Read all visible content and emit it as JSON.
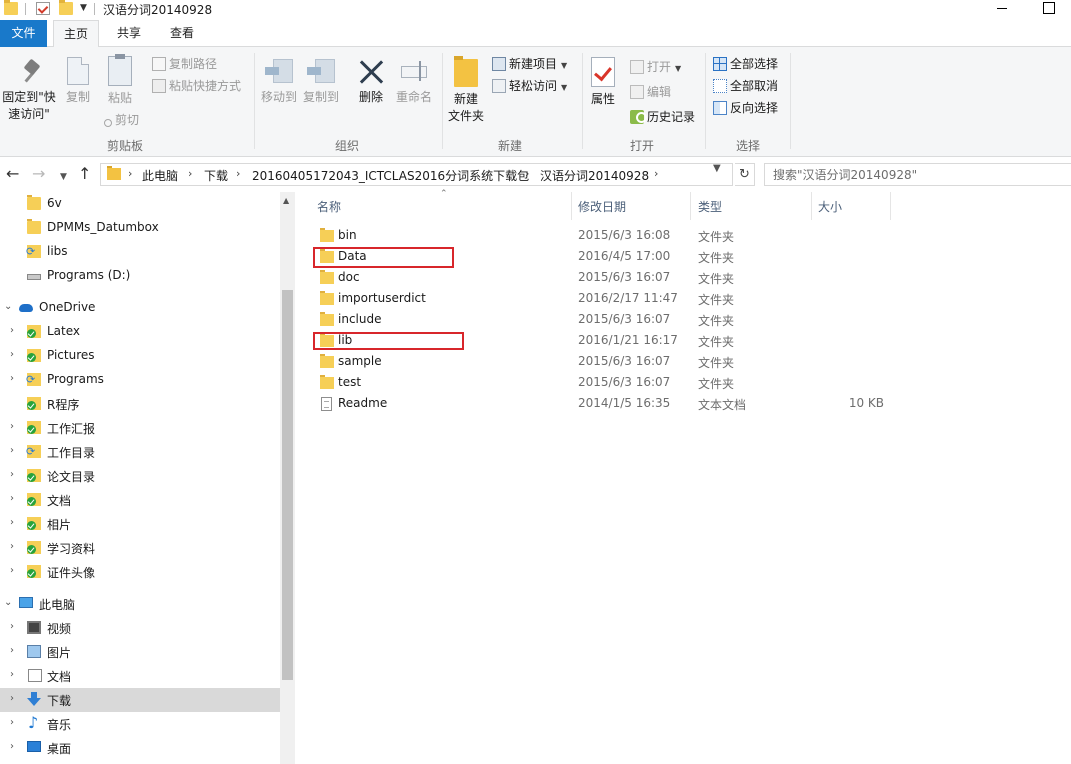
{
  "window": {
    "title": "汉语分词20140928"
  },
  "ribbon_tabs": {
    "file": "文件",
    "home": "主页",
    "share": "共享",
    "view": "查看"
  },
  "ribbon": {
    "clipboard": {
      "pin_quick_access_line1": "固定到\"快",
      "pin_quick_access_line2": "速访问\"",
      "copy": "复制",
      "paste": "粘贴",
      "copy_path": "复制路径",
      "paste_shortcut": "粘贴快捷方式",
      "cut": "剪切",
      "group_label": "剪贴板"
    },
    "organize": {
      "move_to": "移动到",
      "copy_to": "复制到",
      "delete": "删除",
      "rename": "重命名",
      "group_label": "组织"
    },
    "new": {
      "new_folder_line1": "新建",
      "new_folder_line2": "文件夹",
      "new_item": "新建项目",
      "easy_access": "轻松访问",
      "group_label": "新建"
    },
    "open": {
      "properties": "属性",
      "open": "打开",
      "edit": "编辑",
      "history": "历史记录",
      "group_label": "打开"
    },
    "select": {
      "select_all": "全部选择",
      "select_none": "全部取消",
      "invert_selection": "反向选择",
      "group_label": "选择"
    }
  },
  "address": {
    "breadcrumbs": [
      "此电脑",
      "下载",
      "20160405172043_ICTCLAS2016分词系统下载包",
      "汉语分词20140928"
    ],
    "search_placeholder": "搜索\"汉语分词20140928\""
  },
  "nav_pane": {
    "items": [
      {
        "label": "6v",
        "icon": "folder-icon"
      },
      {
        "label": "DPMMs_Datumbox",
        "icon": "folder-icon"
      },
      {
        "label": "libs",
        "icon": "sync-folder-icon"
      },
      {
        "label": "Programs (D:)",
        "icon": "drive-icon"
      },
      {
        "label": "OneDrive",
        "icon": "onedrive-icon"
      },
      {
        "label": "Latex",
        "icon": "synced-folder-icon"
      },
      {
        "label": "Pictures",
        "icon": "synced-folder-icon"
      },
      {
        "label": "Programs",
        "icon": "sync-folder-icon"
      },
      {
        "label": "R程序",
        "icon": "synced-folder-icon"
      },
      {
        "label": "工作汇报",
        "icon": "synced-folder-icon"
      },
      {
        "label": "工作目录",
        "icon": "sync-folder-icon"
      },
      {
        "label": "论文目录",
        "icon": "synced-folder-icon"
      },
      {
        "label": "文档",
        "icon": "synced-folder-icon"
      },
      {
        "label": "相片",
        "icon": "synced-folder-icon"
      },
      {
        "label": "学习资料",
        "icon": "synced-folder-icon"
      },
      {
        "label": "证件头像",
        "icon": "synced-folder-icon"
      },
      {
        "label": "此电脑",
        "icon": "this-pc-icon"
      },
      {
        "label": "视频",
        "icon": "videos-icon"
      },
      {
        "label": "图片",
        "icon": "pictures-icon"
      },
      {
        "label": "文档",
        "icon": "documents-icon"
      },
      {
        "label": "下载",
        "icon": "downloads-icon"
      },
      {
        "label": "音乐",
        "icon": "music-icon"
      },
      {
        "label": "桌面",
        "icon": "desktop-icon"
      }
    ]
  },
  "file_list": {
    "columns": {
      "name": "名称",
      "date": "修改日期",
      "type": "类型",
      "size": "大小"
    },
    "rows": [
      {
        "name": "bin",
        "date": "2015/6/3 16:08",
        "type": "文件夹",
        "size": ""
      },
      {
        "name": "Data",
        "date": "2016/4/5 17:00",
        "type": "文件夹",
        "size": ""
      },
      {
        "name": "doc",
        "date": "2015/6/3 16:07",
        "type": "文件夹",
        "size": ""
      },
      {
        "name": "importuserdict",
        "date": "2016/2/17 11:47",
        "type": "文件夹",
        "size": ""
      },
      {
        "name": "include",
        "date": "2015/6/3 16:07",
        "type": "文件夹",
        "size": ""
      },
      {
        "name": "lib",
        "date": "2016/1/21 16:17",
        "type": "文件夹",
        "size": ""
      },
      {
        "name": "sample",
        "date": "2015/6/3 16:07",
        "type": "文件夹",
        "size": ""
      },
      {
        "name": "test",
        "date": "2015/6/3 16:07",
        "type": "文件夹",
        "size": ""
      },
      {
        "name": "Readme",
        "date": "2014/1/5 16:35",
        "type": "文本文档",
        "size": "10 KB"
      }
    ]
  },
  "colors": {
    "file_tab_blue": "#1979ca",
    "folder_yellow": "#f6cf57",
    "highlight_red": "#d8262b",
    "selected_nav_gray": "#d9d9d9"
  }
}
